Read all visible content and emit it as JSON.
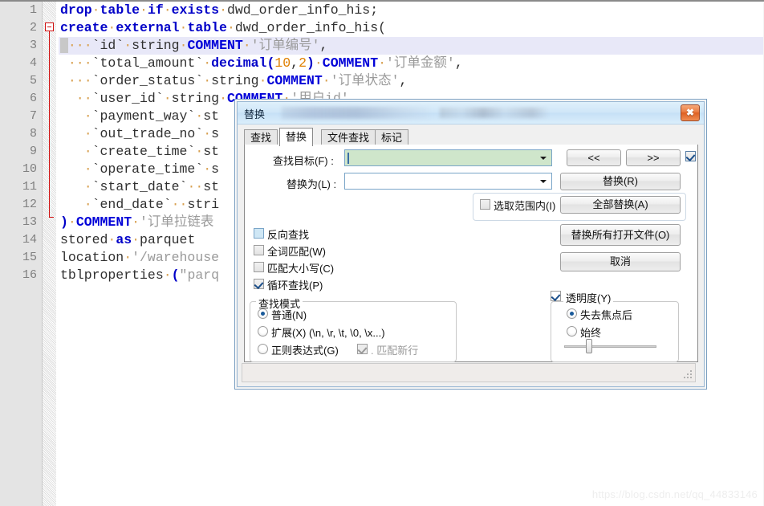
{
  "editor": {
    "line_numbers": [
      "1",
      "2",
      "3",
      "4",
      "5",
      "6",
      "7",
      "8",
      "9",
      "10",
      "11",
      "12",
      "13",
      "14",
      "15",
      "16"
    ],
    "lines": [
      {
        "n": "1",
        "text": "drop table if exists dwd_order_info_his;"
      },
      {
        "n": "2",
        "text": "create external table dwd_order_info_his("
      },
      {
        "n": "3",
        "text": "    `id` string COMMENT '订单编号',"
      },
      {
        "n": "4",
        "text": "    `total_amount` decimal(10,2) COMMENT '订单金额',"
      },
      {
        "n": "5",
        "text": "    `order_status` string COMMENT '订单状态',"
      },
      {
        "n": "6",
        "text": "    `user_id` string COMMENT '用户id',"
      },
      {
        "n": "7",
        "text": "    `payment_way` st"
      },
      {
        "n": "8",
        "text": "    `out_trade_no` s"
      },
      {
        "n": "9",
        "text": "    `create_time` st"
      },
      {
        "n": "10",
        "text": "    `operate_time` s"
      },
      {
        "n": "11",
        "text": "    `start_date`  st"
      },
      {
        "n": "12",
        "text": "    `end_date`  stri"
      },
      {
        "n": "13",
        "text": ") COMMENT '订单拉链表"
      },
      {
        "n": "14",
        "text": "stored as parquet"
      },
      {
        "n": "15",
        "text": "location '/warehouse"
      },
      {
        "n": "16",
        "text": "tblproperties (\"parq"
      }
    ]
  },
  "dialog": {
    "title": "替换",
    "close_label": "✖",
    "tabs": [
      {
        "label": "查找",
        "active": false
      },
      {
        "label": "替换",
        "active": true
      },
      {
        "label": "文件查找",
        "active": false
      },
      {
        "label": "标记",
        "active": false
      }
    ],
    "fields": {
      "find_label": "查找目标(F) :",
      "find_value": "",
      "replace_label": "替换为(L) :",
      "replace_value": ""
    },
    "buttons": {
      "prev": "<<",
      "next": ">>",
      "replace": "替换(R)",
      "replace_all": "全部替换(A)",
      "replace_all_open_files": "替换所有打开文件(O)",
      "cancel": "取消"
    },
    "checkboxes": {
      "in_selection": {
        "label": "选取范围内(I)",
        "checked": false
      },
      "backward": {
        "label": "反向查找",
        "checked": false
      },
      "whole_word": {
        "label": "全词匹配(W)",
        "checked": false
      },
      "match_case": {
        "label": "匹配大小写(C)",
        "checked": false
      },
      "wrap_around": {
        "label": "循环查找(P)",
        "checked": true
      },
      "next_toggle": {
        "label": "",
        "checked": true
      },
      "match_newline": {
        "label": ". 匹配新行",
        "checked": true,
        "disabled": true
      },
      "transparency": {
        "label": "透明度(Y)",
        "checked": true
      }
    },
    "search_mode": {
      "title": "查找模式",
      "options": [
        {
          "label": "普通(N)",
          "selected": true
        },
        {
          "label": "扩展(X) (\\n, \\r, \\t, \\0, \\x...)",
          "selected": false
        },
        {
          "label": "正则表达式(G)",
          "selected": false
        }
      ]
    },
    "transparency": {
      "title": "透明度(Y)",
      "options": [
        {
          "label": "失去焦点后",
          "selected": true
        },
        {
          "label": "始终",
          "selected": false
        }
      ],
      "slider_value": 22
    }
  },
  "watermark": {
    "text": "https://blog.csdn.net/qq_44833146"
  },
  "colors": {
    "keyword": "#0000c8",
    "string": "#9a9a9a",
    "number": "#e08000",
    "gutter": "#e4e4e4",
    "highlight": "#e8e8f8",
    "fold_marker": "#d01010",
    "title_gradient": "#cfe6f8",
    "input_green": "#cfe6cb"
  }
}
